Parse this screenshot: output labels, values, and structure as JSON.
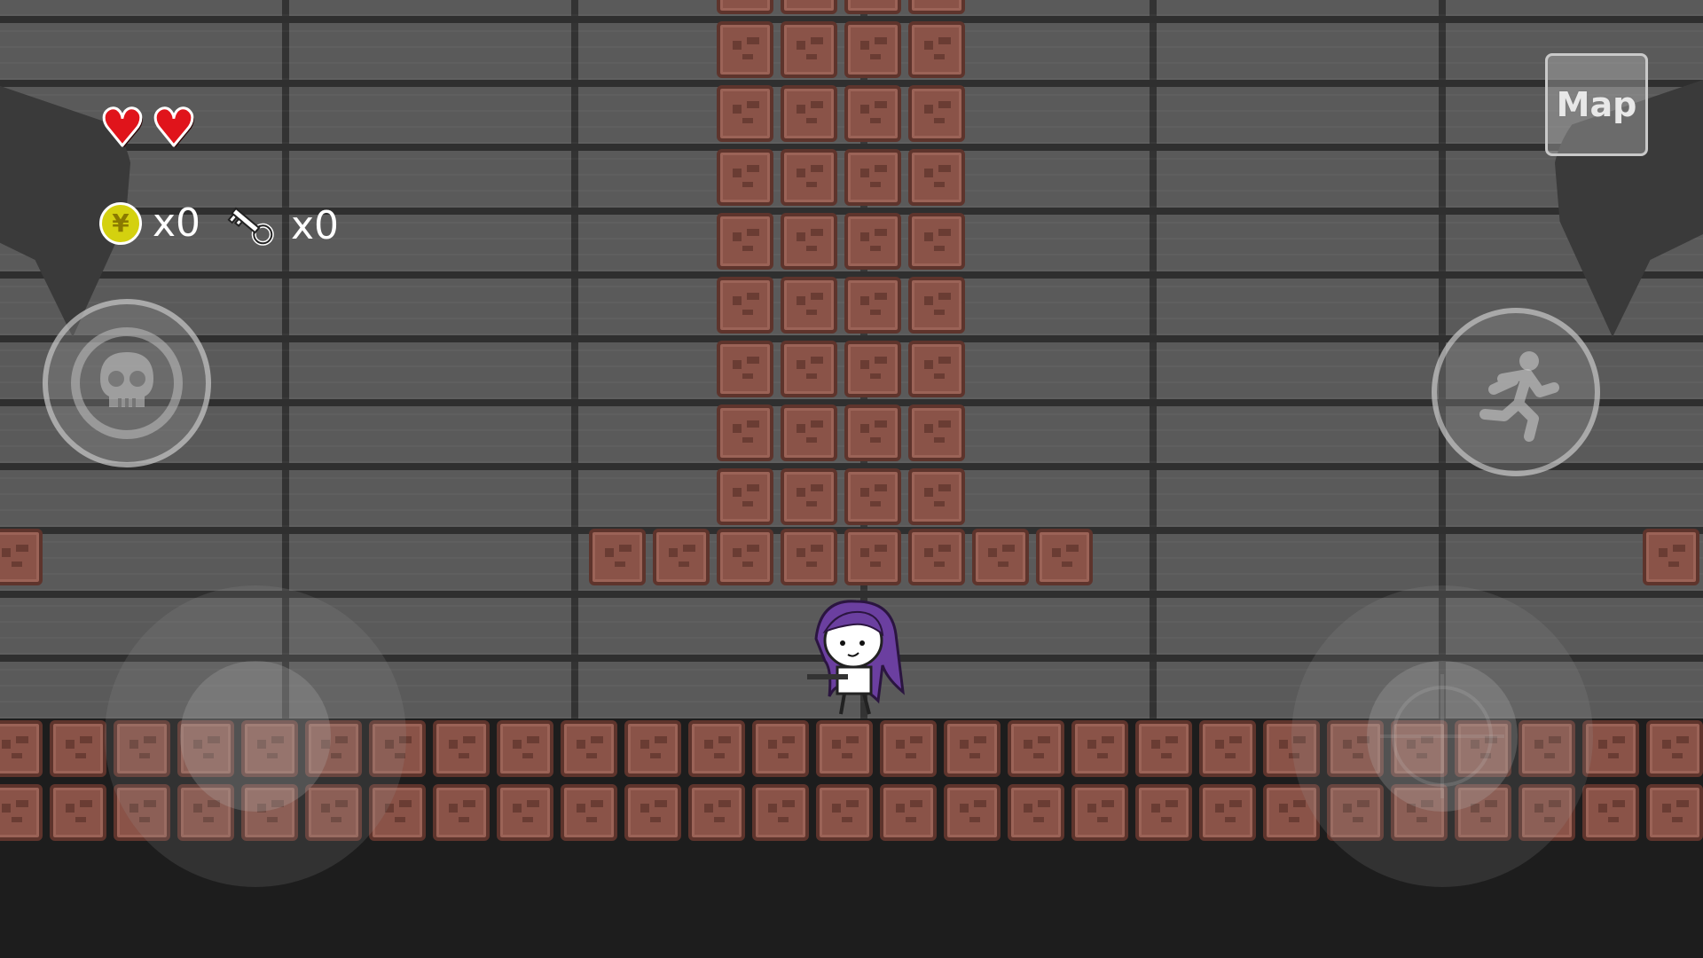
{
  "hud": {
    "hearts": {
      "count": 2,
      "icon": "heart-icon",
      "color": "#e0141b"
    },
    "coins": {
      "icon": "yen-coin-icon",
      "symbol": "¥",
      "count_text": "x0"
    },
    "keys": {
      "icon": "key-icon",
      "count_text": "x0"
    },
    "map_button": {
      "label": "Map"
    }
  },
  "controls": {
    "skull_button": {
      "icon": "skull-icon"
    },
    "run_button": {
      "icon": "running-person-icon"
    },
    "move_joystick": {
      "icon": "joystick"
    },
    "aim_joystick": {
      "icon": "crosshair-joystick"
    }
  },
  "colors": {
    "wall": "#5a5a5a",
    "brick": "#8a5348",
    "brick_border": "#5e342c",
    "floor": "#1d1d1d"
  }
}
